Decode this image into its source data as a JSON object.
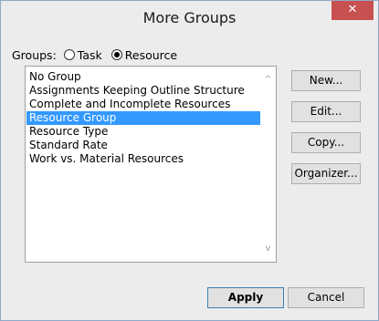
{
  "dialog": {
    "title": "More Groups",
    "close_icon": "close-icon"
  },
  "groups": {
    "label": "Groups:",
    "options": [
      {
        "label": "Task",
        "checked": false
      },
      {
        "label": "Resource",
        "checked": true
      }
    ]
  },
  "list": {
    "items": [
      {
        "label": "No Group",
        "selected": false
      },
      {
        "label": "Assignments Keeping Outline Structure",
        "selected": false
      },
      {
        "label": "Complete and Incomplete Resources",
        "selected": false
      },
      {
        "label": "Resource Group",
        "selected": true
      },
      {
        "label": "Resource Type",
        "selected": false
      },
      {
        "label": "Standard Rate",
        "selected": false
      },
      {
        "label": "Work vs. Material Resources",
        "selected": false
      }
    ]
  },
  "buttons": {
    "new": "New...",
    "edit": "Edit...",
    "copy": "Copy...",
    "organizer": "Organizer...",
    "apply": "Apply",
    "cancel": "Cancel"
  },
  "colors": {
    "selection": "#3399ff",
    "close": "#c75050"
  }
}
